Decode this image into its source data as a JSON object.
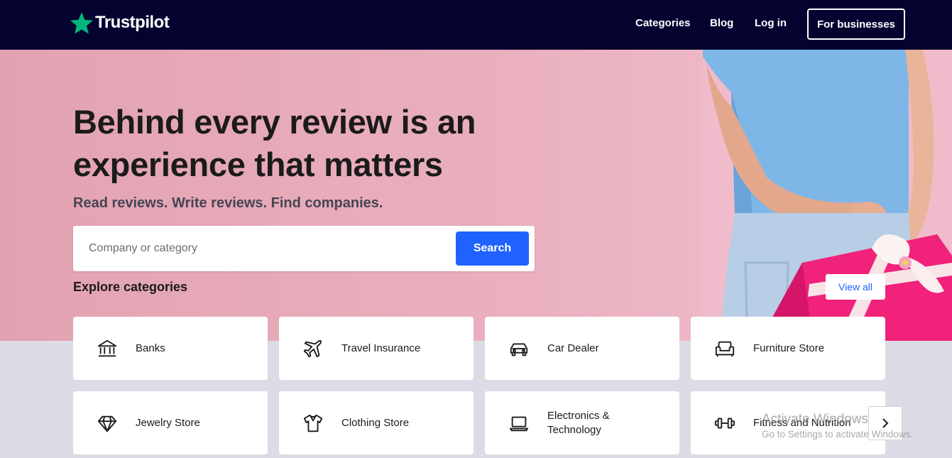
{
  "nav": {
    "logo_text": "Trustpilot",
    "links": [
      {
        "label": "Categories"
      },
      {
        "label": "Blog"
      },
      {
        "label": "Log in"
      }
    ],
    "business_button": "For businesses"
  },
  "hero": {
    "headline_line1": "Behind every review is an",
    "headline_line2": "experience that matters",
    "subheadline": "Read reviews. Write reviews. Find companies.",
    "search": {
      "placeholder": "Company or category",
      "value": "",
      "button_label": "Search"
    }
  },
  "categories": {
    "title": "Explore categories",
    "view_all_label": "View all",
    "items": [
      {
        "label": "Banks",
        "icon": "bank-icon"
      },
      {
        "label": "Travel Insurance",
        "icon": "airplane-icon"
      },
      {
        "label": "Car Dealer",
        "icon": "car-icon"
      },
      {
        "label": "Furniture Store",
        "icon": "armchair-icon"
      },
      {
        "label": "Jewelry Store",
        "icon": "diamond-icon"
      },
      {
        "label": "Clothing Store",
        "icon": "shirt-icon"
      },
      {
        "label": "Electronics & Technology",
        "icon": "laptop-icon"
      },
      {
        "label": "Fitness and Nutrition",
        "icon": "dumbbell-icon"
      }
    ]
  },
  "watermark": {
    "title": "Activate Windows",
    "subtitle": "Go to Settings to activate Windows."
  },
  "colors": {
    "nav_bg": "#04032f",
    "brand_green": "#00b67a",
    "accent_blue": "#1f62ff",
    "hero_pink": "#e8a9b8",
    "page_bg": "#dcdce6"
  }
}
